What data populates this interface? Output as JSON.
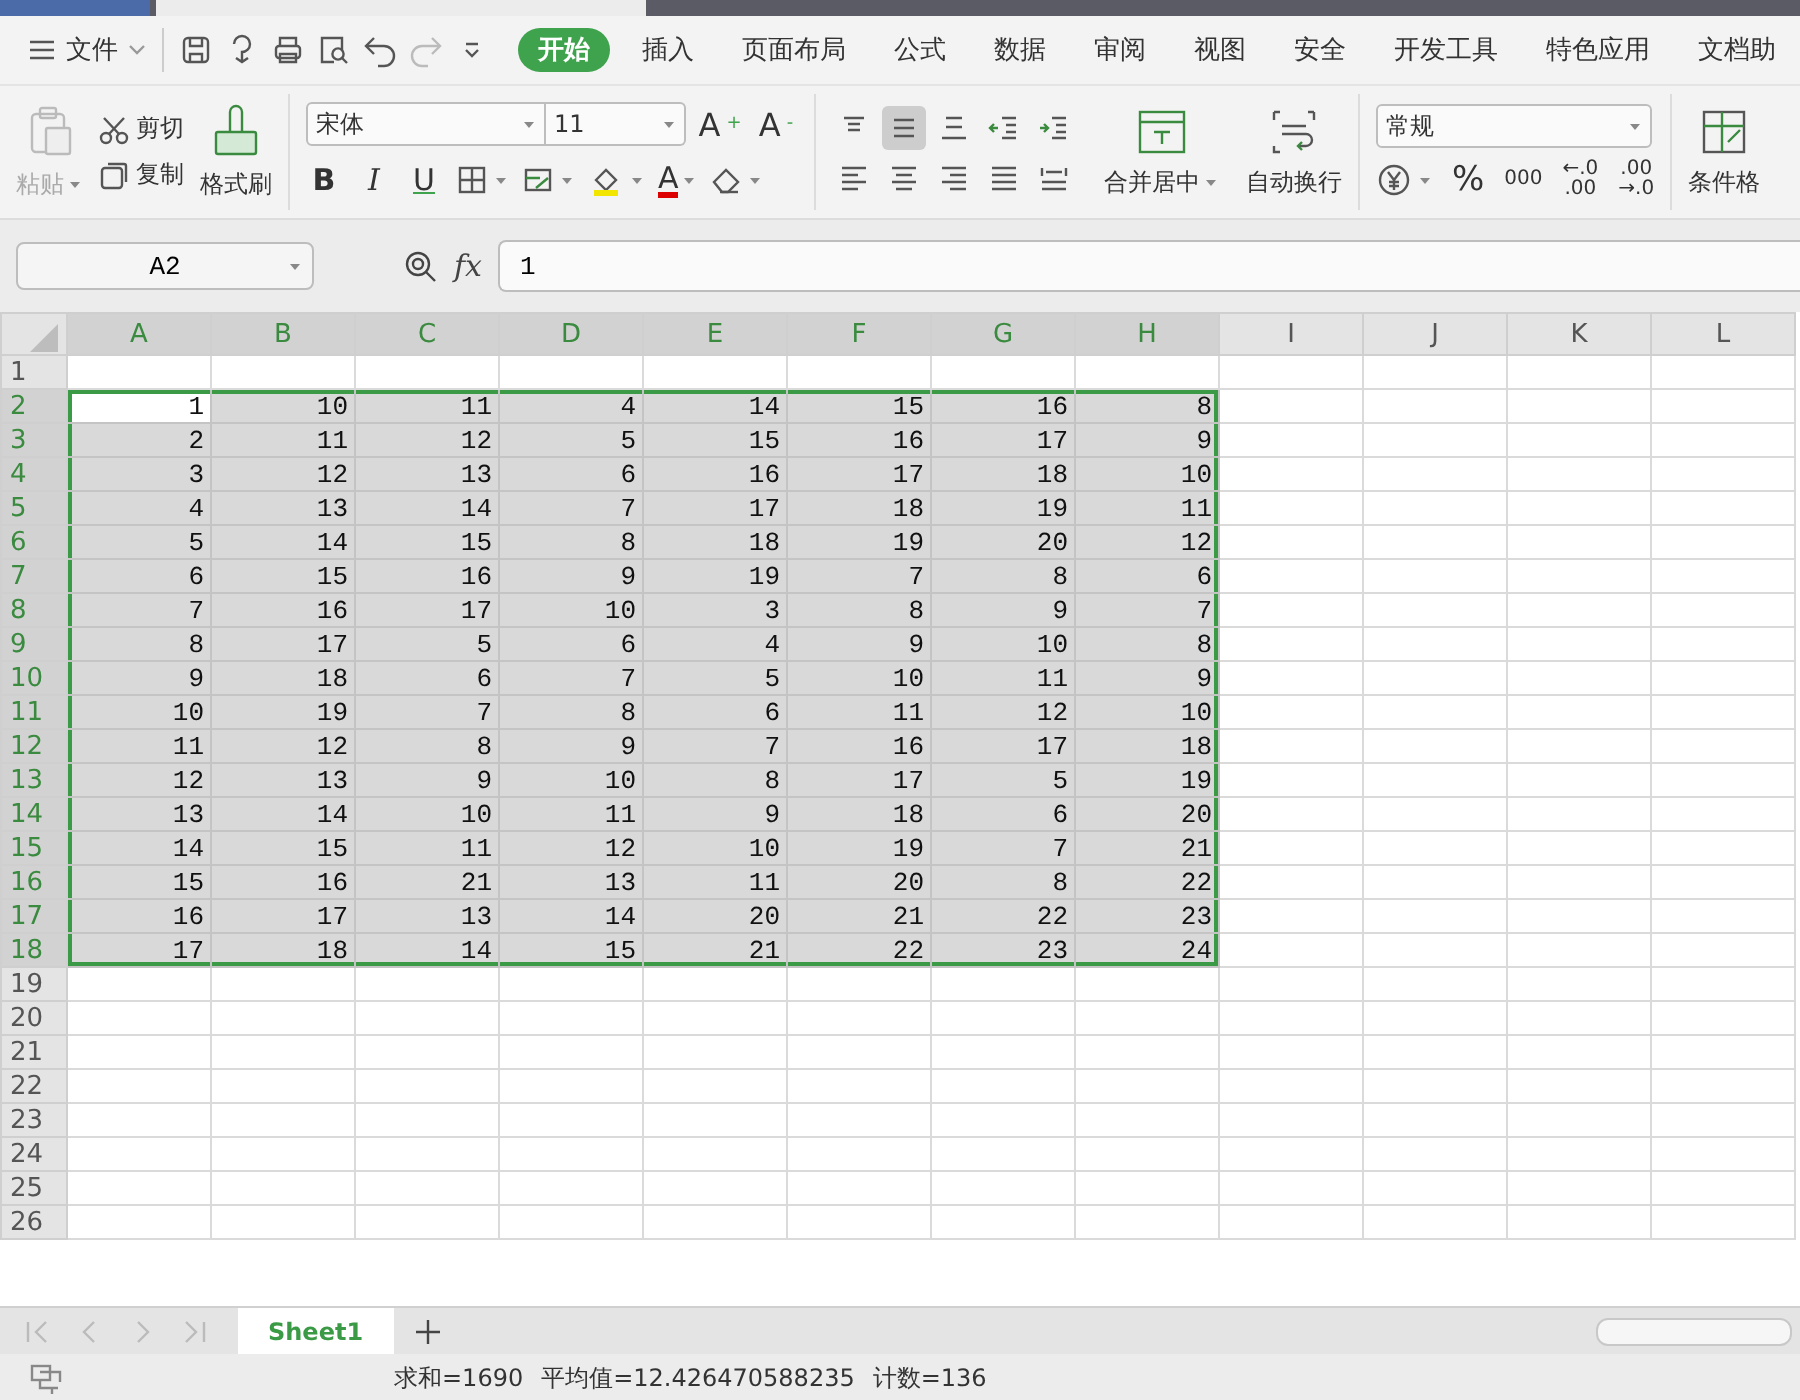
{
  "menu": {
    "file_label": "文件",
    "quick_access": [
      {
        "kind": "save",
        "disabled": false
      },
      {
        "kind": "sync",
        "disabled": false
      },
      {
        "kind": "print",
        "disabled": false
      },
      {
        "kind": "preview",
        "disabled": false
      },
      {
        "kind": "undo",
        "disabled": false
      },
      {
        "kind": "redo",
        "disabled": true
      },
      {
        "kind": "more",
        "disabled": false
      }
    ],
    "tabs": [
      {
        "label": "开始",
        "selected": true
      },
      {
        "label": "插入",
        "selected": false
      },
      {
        "label": "页面布局",
        "selected": false
      },
      {
        "label": "公式",
        "selected": false
      },
      {
        "label": "数据",
        "selected": false
      },
      {
        "label": "审阅",
        "selected": false
      },
      {
        "label": "视图",
        "selected": false
      },
      {
        "label": "安全",
        "selected": false
      },
      {
        "label": "开发工具",
        "selected": false
      },
      {
        "label": "特色应用",
        "selected": false
      },
      {
        "label": "文档助",
        "selected": false
      }
    ]
  },
  "ribbon": {
    "clipboard": {
      "paste": {
        "label": "粘贴",
        "disabled": true
      },
      "cut": "剪切",
      "copy": "复制",
      "format_painter": "格式刷"
    },
    "font": {
      "name": "宋体",
      "size": "11",
      "grow": "A$^{+}$",
      "shrink": "A$^{-}$",
      "bold": "B",
      "italic": "I",
      "underline": "U",
      "font_color": "A"
    },
    "alignment": {
      "buttons": [
        {
          "kind": "top",
          "selected": false
        },
        {
          "kind": "middle",
          "selected": true
        },
        {
          "kind": "bottom",
          "selected": false
        },
        {
          "kind": "indent-decrease",
          "selected": false
        },
        {
          "kind": "indent-increase",
          "selected": false
        },
        {
          "kind": "left",
          "selected": false
        },
        {
          "kind": "center",
          "selected": false
        },
        {
          "kind": "right",
          "selected": false
        },
        {
          "kind": "justify",
          "selected": false
        },
        {
          "kind": "distributed",
          "selected": false
        }
      ],
      "merge": "合并居中",
      "wrap": "自动换行"
    },
    "number": {
      "format": "常规",
      "percent": "%",
      "thousands": "000",
      "increase_decimal": [
        "←.0",
        ".00"
      ],
      "decrease_decimal": [
        ".00",
        "→.0"
      ]
    },
    "conditional_format": "条件格"
  },
  "formula_bar": {
    "cell_ref": "A2",
    "fx": "fx",
    "value": "1"
  },
  "grid": {
    "columns": [
      {
        "label": "A",
        "selected": true
      },
      {
        "label": "B",
        "selected": true
      },
      {
        "label": "C",
        "selected": true
      },
      {
        "label": "D",
        "selected": true
      },
      {
        "label": "E",
        "selected": true
      },
      {
        "label": "F",
        "selected": true
      },
      {
        "label": "G",
        "selected": true
      },
      {
        "label": "H",
        "selected": true
      },
      {
        "label": "I",
        "selected": false
      },
      {
        "label": "J",
        "selected": false
      },
      {
        "label": "K",
        "selected": false
      },
      {
        "label": "L",
        "selected": false
      }
    ],
    "rows": [
      {
        "label": "1",
        "selected": false,
        "cells": []
      },
      {
        "label": "2",
        "selected": true,
        "cells": [
          {
            "value": "1",
            "active": true
          },
          {
            "value": "10",
            "active": false
          },
          {
            "value": "11",
            "active": false
          },
          {
            "value": "4",
            "active": false
          },
          {
            "value": "14",
            "active": false
          },
          {
            "value": "15",
            "active": false
          },
          {
            "value": "16",
            "active": false
          },
          {
            "value": "8",
            "active": false
          }
        ]
      },
      {
        "label": "3",
        "selected": true,
        "cells": [
          {
            "value": "2",
            "active": false
          },
          {
            "value": "11",
            "active": false
          },
          {
            "value": "12",
            "active": false
          },
          {
            "value": "5",
            "active": false
          },
          {
            "value": "15",
            "active": false
          },
          {
            "value": "16",
            "active": false
          },
          {
            "value": "17",
            "active": false
          },
          {
            "value": "9",
            "active": false
          }
        ]
      },
      {
        "label": "4",
        "selected": true,
        "cells": [
          {
            "value": "3",
            "active": false
          },
          {
            "value": "12",
            "active": false
          },
          {
            "value": "13",
            "active": false
          },
          {
            "value": "6",
            "active": false
          },
          {
            "value": "16",
            "active": false
          },
          {
            "value": "17",
            "active": false
          },
          {
            "value": "18",
            "active": false
          },
          {
            "value": "10",
            "active": false
          }
        ]
      },
      {
        "label": "5",
        "selected": true,
        "cells": [
          {
            "value": "4",
            "active": false
          },
          {
            "value": "13",
            "active": false
          },
          {
            "value": "14",
            "active": false
          },
          {
            "value": "7",
            "active": false
          },
          {
            "value": "17",
            "active": false
          },
          {
            "value": "18",
            "active": false
          },
          {
            "value": "19",
            "active": false
          },
          {
            "value": "11",
            "active": false
          }
        ]
      },
      {
        "label": "6",
        "selected": true,
        "cells": [
          {
            "value": "5",
            "active": false
          },
          {
            "value": "14",
            "active": false
          },
          {
            "value": "15",
            "active": false
          },
          {
            "value": "8",
            "active": false
          },
          {
            "value": "18",
            "active": false
          },
          {
            "value": "19",
            "active": false
          },
          {
            "value": "20",
            "active": false
          },
          {
            "value": "12",
            "active": false
          }
        ]
      },
      {
        "label": "7",
        "selected": true,
        "cells": [
          {
            "value": "6",
            "active": false
          },
          {
            "value": "15",
            "active": false
          },
          {
            "value": "16",
            "active": false
          },
          {
            "value": "9",
            "active": false
          },
          {
            "value": "19",
            "active": false
          },
          {
            "value": "7",
            "active": false
          },
          {
            "value": "8",
            "active": false
          },
          {
            "value": "6",
            "active": false
          }
        ]
      },
      {
        "label": "8",
        "selected": true,
        "cells": [
          {
            "value": "7",
            "active": false
          },
          {
            "value": "16",
            "active": false
          },
          {
            "value": "17",
            "active": false
          },
          {
            "value": "10",
            "active": false
          },
          {
            "value": "3",
            "active": false
          },
          {
            "value": "8",
            "active": false
          },
          {
            "value": "9",
            "active": false
          },
          {
            "value": "7",
            "active": false
          }
        ]
      },
      {
        "label": "9",
        "selected": true,
        "cells": [
          {
            "value": "8",
            "active": false
          },
          {
            "value": "17",
            "active": false
          },
          {
            "value": "5",
            "active": false
          },
          {
            "value": "6",
            "active": false
          },
          {
            "value": "4",
            "active": false
          },
          {
            "value": "9",
            "active": false
          },
          {
            "value": "10",
            "active": false
          },
          {
            "value": "8",
            "active": false
          }
        ]
      },
      {
        "label": "10",
        "selected": true,
        "cells": [
          {
            "value": "9",
            "active": false
          },
          {
            "value": "18",
            "active": false
          },
          {
            "value": "6",
            "active": false
          },
          {
            "value": "7",
            "active": false
          },
          {
            "value": "5",
            "active": false
          },
          {
            "value": "10",
            "active": false
          },
          {
            "value": "11",
            "active": false
          },
          {
            "value": "9",
            "active": false
          }
        ]
      },
      {
        "label": "11",
        "selected": true,
        "cells": [
          {
            "value": "10",
            "active": false
          },
          {
            "value": "19",
            "active": false
          },
          {
            "value": "7",
            "active": false
          },
          {
            "value": "8",
            "active": false
          },
          {
            "value": "6",
            "active": false
          },
          {
            "value": "11",
            "active": false
          },
          {
            "value": "12",
            "active": false
          },
          {
            "value": "10",
            "active": false
          }
        ]
      },
      {
        "label": "12",
        "selected": true,
        "cells": [
          {
            "value": "11",
            "active": false
          },
          {
            "value": "12",
            "active": false
          },
          {
            "value": "8",
            "active": false
          },
          {
            "value": "9",
            "active": false
          },
          {
            "value": "7",
            "active": false
          },
          {
            "value": "16",
            "active": false
          },
          {
            "value": "17",
            "active": false
          },
          {
            "value": "18",
            "active": false
          }
        ]
      },
      {
        "label": "13",
        "selected": true,
        "cells": [
          {
            "value": "12",
            "active": false
          },
          {
            "value": "13",
            "active": false
          },
          {
            "value": "9",
            "active": false
          },
          {
            "value": "10",
            "active": false
          },
          {
            "value": "8",
            "active": false
          },
          {
            "value": "17",
            "active": false
          },
          {
            "value": "5",
            "active": false
          },
          {
            "value": "19",
            "active": false
          }
        ]
      },
      {
        "label": "14",
        "selected": true,
        "cells": [
          {
            "value": "13",
            "active": false
          },
          {
            "value": "14",
            "active": false
          },
          {
            "value": "10",
            "active": false
          },
          {
            "value": "11",
            "active": false
          },
          {
            "value": "9",
            "active": false
          },
          {
            "value": "18",
            "active": false
          },
          {
            "value": "6",
            "active": false
          },
          {
            "value": "20",
            "active": false
          }
        ]
      },
      {
        "label": "15",
        "selected": true,
        "cells": [
          {
            "value": "14",
            "active": false
          },
          {
            "value": "15",
            "active": false
          },
          {
            "value": "11",
            "active": false
          },
          {
            "value": "12",
            "active": false
          },
          {
            "value": "10",
            "active": false
          },
          {
            "value": "19",
            "active": false
          },
          {
            "value": "7",
            "active": false
          },
          {
            "value": "21",
            "active": false
          }
        ]
      },
      {
        "label": "16",
        "selected": true,
        "cells": [
          {
            "value": "15",
            "active": false
          },
          {
            "value": "16",
            "active": false
          },
          {
            "value": "21",
            "active": false
          },
          {
            "value": "13",
            "active": false
          },
          {
            "value": "11",
            "active": false
          },
          {
            "value": "20",
            "active": false
          },
          {
            "value": "8",
            "active": false
          },
          {
            "value": "22",
            "active": false
          }
        ]
      },
      {
        "label": "17",
        "selected": true,
        "cells": [
          {
            "value": "16",
            "active": false
          },
          {
            "value": "17",
            "active": false
          },
          {
            "value": "13",
            "active": false
          },
          {
            "value": "14",
            "active": false
          },
          {
            "value": "20",
            "active": false
          },
          {
            "value": "21",
            "active": false
          },
          {
            "value": "22",
            "active": false
          },
          {
            "value": "23",
            "active": false
          }
        ]
      },
      {
        "label": "18",
        "selected": true,
        "cells": [
          {
            "value": "17",
            "active": false
          },
          {
            "value": "18",
            "active": false
          },
          {
            "value": "14",
            "active": false
          },
          {
            "value": "15",
            "active": false
          },
          {
            "value": "21",
            "active": false
          },
          {
            "value": "22",
            "active": false
          },
          {
            "value": "23",
            "active": false
          },
          {
            "value": "24",
            "active": false
          }
        ]
      },
      {
        "label": "19",
        "selected": false,
        "cells": []
      },
      {
        "label": "20",
        "selected": false,
        "cells": []
      },
      {
        "label": "21",
        "selected": false,
        "cells": []
      },
      {
        "label": "22",
        "selected": false,
        "cells": []
      },
      {
        "label": "23",
        "selected": false,
        "cells": []
      },
      {
        "label": "24",
        "selected": false,
        "cells": []
      },
      {
        "label": "25",
        "selected": false,
        "cells": []
      },
      {
        "label": "26",
        "selected": false,
        "cells": []
      }
    ]
  },
  "sheets": [
    {
      "label": "Sheet1",
      "selected": true
    }
  ],
  "status": [
    "求和=1690",
    "平均值=12.426470588235",
    "计数=136"
  ]
}
